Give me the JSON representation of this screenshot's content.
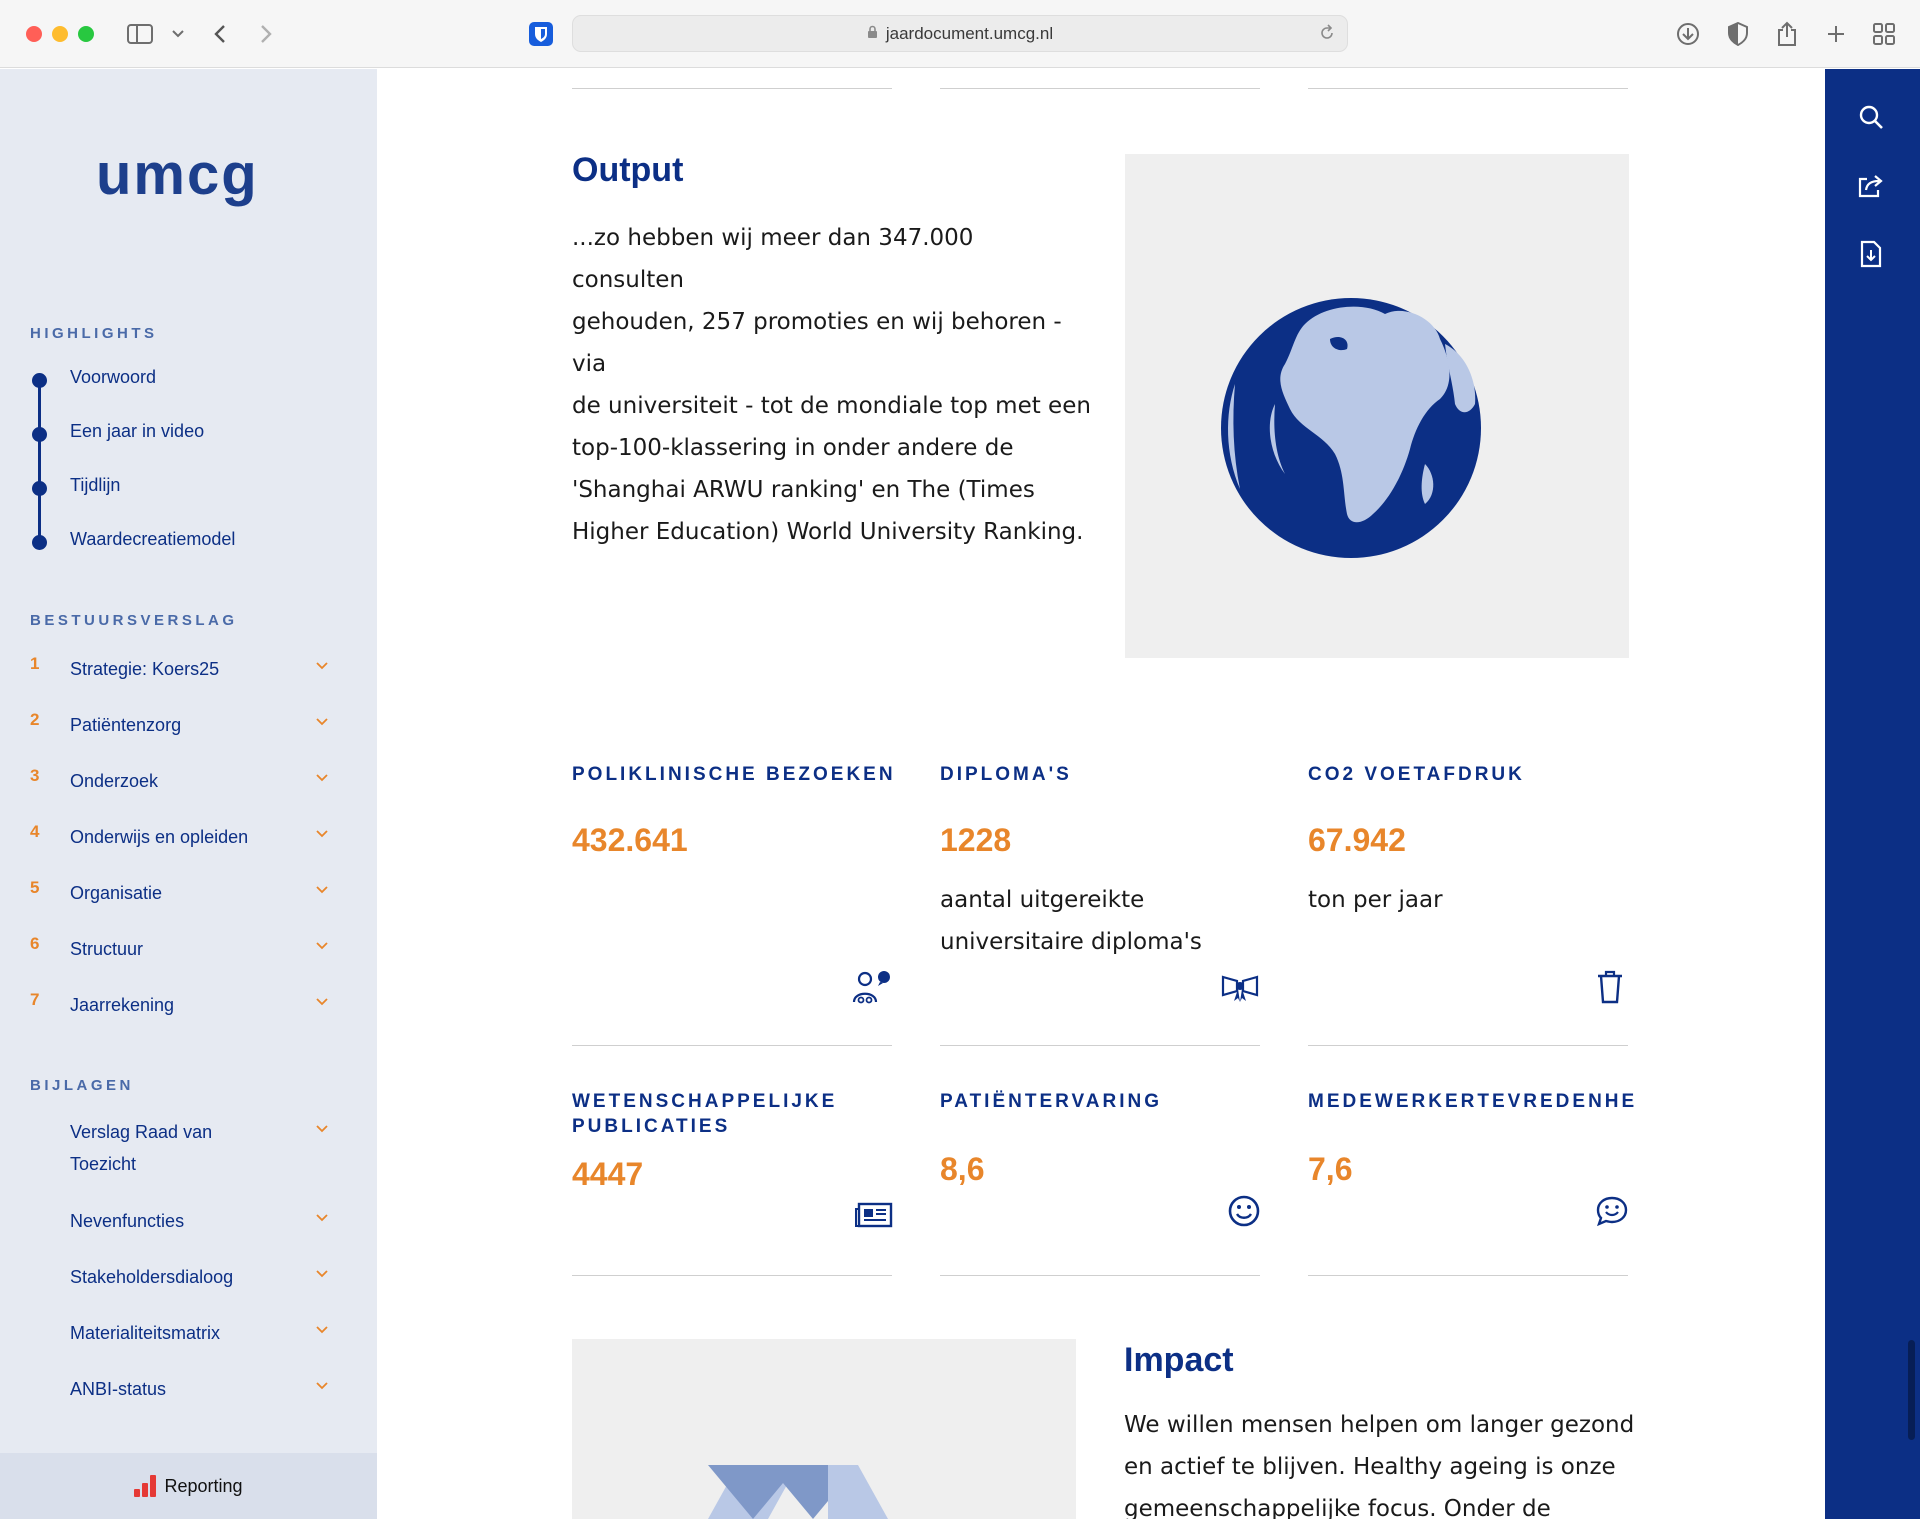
{
  "browser": {
    "url": "jaardocument.umcg.nl"
  },
  "sidebar": {
    "logo": "umcg",
    "highlights_heading": "HIGHLIGHTS",
    "highlights": [
      {
        "label": "Voorwoord"
      },
      {
        "label": "Een jaar in video"
      },
      {
        "label": "Tijdlijn"
      },
      {
        "label": "Waardecreatiemodel"
      }
    ],
    "bestuursverslag_heading": "BESTUURSVERSLAG",
    "bestuursverslag": [
      {
        "num": "1",
        "label": "Strategie: Koers25"
      },
      {
        "num": "2",
        "label": "Patiëntenzorg"
      },
      {
        "num": "3",
        "label": "Onderzoek"
      },
      {
        "num": "4",
        "label": "Onderwijs en opleiden"
      },
      {
        "num": "5",
        "label": "Organisatie"
      },
      {
        "num": "6",
        "label": "Structuur"
      },
      {
        "num": "7",
        "label": "Jaarrekening"
      }
    ],
    "bijlagen_heading": "BIJLAGEN",
    "bijlagen": [
      {
        "label_line1": "Verslag Raad van",
        "label_line2": "Toezicht"
      },
      {
        "label": "Nevenfuncties"
      },
      {
        "label": "Stakeholdersdialoog"
      },
      {
        "label": "Materialiteitsmatrix"
      },
      {
        "label": "ANBI-status"
      }
    ],
    "reporting_label": "Reporting"
  },
  "output": {
    "heading": "Output",
    "lines": [
      "...zo hebben wij meer dan 347.000 consulten",
      "gehouden, 257 promoties en wij behoren - via",
      "de universiteit - tot de mondiale top met een",
      "top-100-klassering in onder andere de",
      "'Shanghai ARWU ranking' en The (Times",
      "Higher Education) World University Ranking."
    ]
  },
  "kpis": [
    {
      "title": "POLIKLINISCHE BEZOEKEN",
      "value": "432.641",
      "desc": [],
      "icon": "patients-icon"
    },
    {
      "title": "DIPLOMA'S",
      "value": "1228",
      "desc": [
        "aantal uitgereikte",
        "universitaire diploma's"
      ],
      "icon": "diploma-icon"
    },
    {
      "title": "CO2 VOETAFDRUK",
      "value": "67.942",
      "desc": [
        "ton per jaar"
      ],
      "icon": "trash-icon"
    },
    {
      "title_line1": "WETENSCHAPPELIJKE",
      "title_line2": "PUBLICATIES",
      "value": "4447",
      "icon": "newspaper-icon"
    },
    {
      "title": "PATIËNTERVARING",
      "value": "8,6",
      "icon": "smiley-icon"
    },
    {
      "title": "MEDEWERKERTEVREDENHE",
      "value": "7,6",
      "icon": "chat-smile-icon"
    }
  ],
  "impact": {
    "heading": "Impact",
    "lines": [
      "We willen mensen helpen om langer gezond",
      "en actief te blijven. Healthy ageing is onze",
      "gemeenschappelijke focus. Onder de"
    ]
  },
  "colors": {
    "navy": "#0c2f85",
    "orange": "#e8862b",
    "sidebar_bg": "#e6eaf2",
    "globe_light": "#b9c8e6"
  }
}
